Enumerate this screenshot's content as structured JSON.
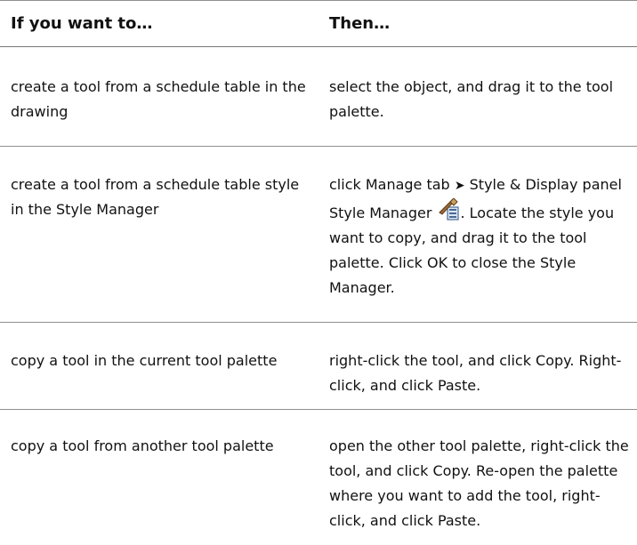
{
  "table": {
    "header": {
      "col1": "If you want to…",
      "col2": "Then…"
    },
    "rows": [
      {
        "left": "create a tool from a schedule table in the drawing",
        "right": "select the object, and drag it to the tool palette."
      },
      {
        "left": "create a tool from a schedule table style in the Style Manager",
        "right_parts": {
          "p1": "click Manage tab",
          "p2": "Style & Display panel",
          "p3": "Style Manager",
          "p4": ". Locate the style you want to copy, and drag it to the tool palette. Click OK to close the Style Manager."
        },
        "arrow_glyph": "➤"
      },
      {
        "left": "copy a tool in the current tool palette",
        "right": "right-click the tool, and click Copy. Right-click, and click Paste."
      },
      {
        "left": "copy a tool from another tool palette",
        "right": "open the other tool palette, right-click the tool, and click Copy. Re-open the palette where you want to add the tool, right-click, and click Paste."
      }
    ]
  },
  "icons": {
    "style_manager": "style-manager-icon"
  }
}
